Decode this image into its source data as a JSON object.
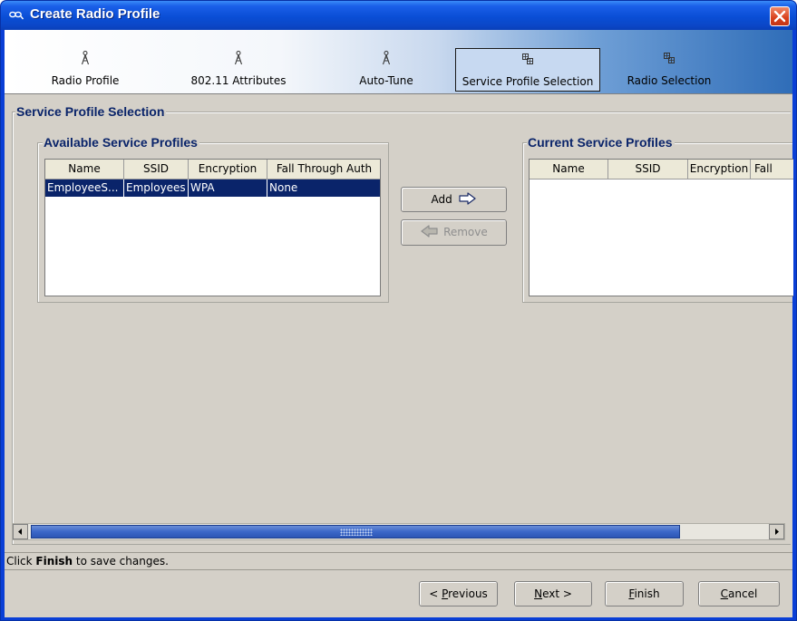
{
  "window": {
    "title": "Create Radio Profile"
  },
  "wizard_steps": [
    {
      "label": "Radio Profile",
      "icon": "antenna-icon",
      "active": false
    },
    {
      "label": "802.11 Attributes",
      "icon": "antenna-icon",
      "active": false
    },
    {
      "label": "Auto-Tune",
      "icon": "antenna-icon",
      "active": false
    },
    {
      "label": "Service Profile Selection",
      "icon": "grid-icon",
      "active": true
    },
    {
      "label": "Radio Selection",
      "icon": "grid-icon",
      "active": false
    }
  ],
  "section": {
    "title": "Service Profile Selection"
  },
  "available": {
    "title": "Available Service Profiles",
    "columns": [
      "Name",
      "SSID",
      "Encryption",
      "Fall Through Auth"
    ],
    "rows": [
      {
        "name": "EmployeeS...",
        "ssid": "Employees",
        "encryption": "WPA",
        "fall_through_auth": "None",
        "selected": true
      }
    ]
  },
  "current": {
    "title": "Current Service Profiles",
    "columns": [
      "Name",
      "SSID",
      "Encryption",
      "Fall"
    ],
    "rows": []
  },
  "actions": {
    "add_label": "Add",
    "remove_label": "Remove"
  },
  "status": {
    "prefix": "Click",
    "bold": "Finish",
    "suffix": "to save changes."
  },
  "buttons": {
    "previous_pre": "< ",
    "previous_mnemonic": "P",
    "previous_post": "revious",
    "next_mnemonic": "N",
    "next_post": "ext >",
    "finish_mnemonic": "F",
    "finish_post": "inish",
    "cancel_mnemonic": "C",
    "cancel_post": "ancel"
  },
  "colors": {
    "titlebar": "#0a4ed6",
    "selection": "#0a246a",
    "group_title": "#0a246a",
    "panel": "#d4d0c8"
  }
}
